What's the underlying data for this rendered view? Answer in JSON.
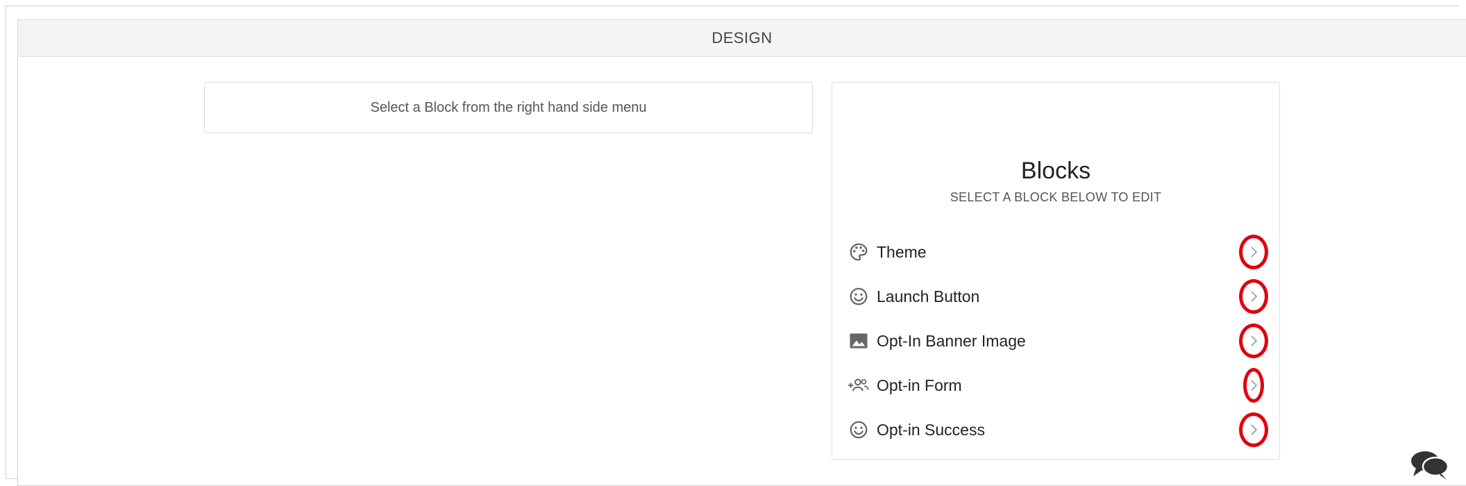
{
  "panel": {
    "title": "DESIGN"
  },
  "left_box": {
    "message": "Select a Block from the right hand side menu"
  },
  "blocks": {
    "title": "Blocks",
    "subtitle": "SELECT A BLOCK BELOW TO EDIT",
    "items": [
      {
        "label": "Theme",
        "icon": "palette-icon"
      },
      {
        "label": "Launch Button",
        "icon": "smiley-icon"
      },
      {
        "label": "Opt-In Banner Image",
        "icon": "image-icon"
      },
      {
        "label": "Opt-in Form",
        "icon": "group-add-icon"
      },
      {
        "label": "Opt-in Success",
        "icon": "smiley-icon"
      }
    ]
  },
  "colors": {
    "highlight_ring": "#e0000f",
    "icon_gray": "#666666",
    "header_bg": "#f4f4f4"
  },
  "chat_widget": {
    "icon": "chat-bubbles-icon"
  }
}
